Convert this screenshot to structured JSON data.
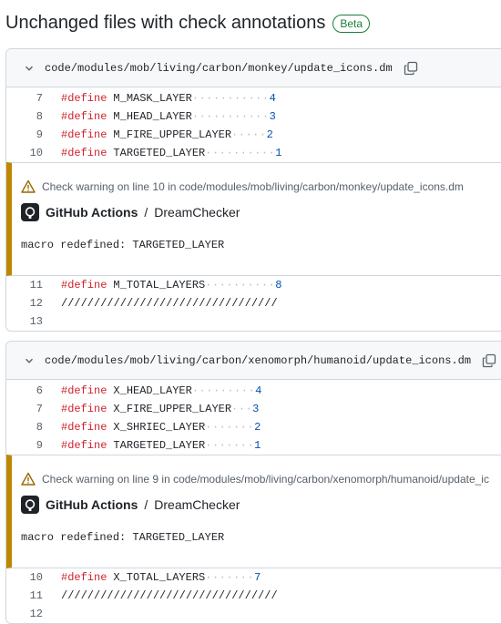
{
  "title": "Unchanged files with check annotations",
  "badge": "Beta",
  "files": [
    {
      "path": "code/modules/mob/living/carbon/monkey/update_icons.dm",
      "lines_before": [
        {
          "n": "7",
          "kw": "#define",
          "name": "M_MASK_LAYER",
          "dots": "···········",
          "val": "4"
        },
        {
          "n": "8",
          "kw": "#define",
          "name": "M_HEAD_LAYER",
          "dots": "···········",
          "val": "3"
        },
        {
          "n": "9",
          "kw": "#define",
          "name": "M_FIRE_UPPER_LAYER",
          "dots": "·····",
          "val": "2"
        },
        {
          "n": "10",
          "kw": "#define",
          "name": "TARGETED_LAYER",
          "dots": "··········",
          "val": "1"
        }
      ],
      "annotation": {
        "title": "Check warning on line 10 in code/modules/mob/living/carbon/monkey/update_icons.dm",
        "source_app": "GitHub Actions",
        "source_sep": "/",
        "source_check": "DreamChecker",
        "message": "macro redefined: TARGETED_LAYER"
      },
      "lines_after": [
        {
          "n": "11",
          "kw": "#define",
          "name": "M_TOTAL_LAYERS",
          "dots": "··········",
          "val": "8"
        },
        {
          "n": "12",
          "kw": "",
          "name": "/////////////////////////////////",
          "dots": "",
          "val": ""
        },
        {
          "n": "13",
          "kw": "",
          "name": "",
          "dots": "",
          "val": ""
        }
      ]
    },
    {
      "path": "code/modules/mob/living/carbon/xenomorph/humanoid/update_icons.dm",
      "lines_before": [
        {
          "n": "6",
          "kw": "#define",
          "name": "X_HEAD_LAYER",
          "dots": "·········",
          "val": "4"
        },
        {
          "n": "7",
          "kw": "#define",
          "name": "X_FIRE_UPPER_LAYER",
          "dots": "···",
          "val": "3"
        },
        {
          "n": "8",
          "kw": "#define",
          "name": "X_SHRIEC_LAYER",
          "dots": "·······",
          "val": "2"
        },
        {
          "n": "9",
          "kw": "#define",
          "name": "TARGETED_LAYER",
          "dots": "·······",
          "val": "1"
        }
      ],
      "annotation": {
        "title": "Check warning on line 9 in code/modules/mob/living/carbon/xenomorph/humanoid/update_ic",
        "source_app": "GitHub Actions",
        "source_sep": "/",
        "source_check": "DreamChecker",
        "message": "macro redefined: TARGETED_LAYER"
      },
      "lines_after": [
        {
          "n": "10",
          "kw": "#define",
          "name": "X_TOTAL_LAYERS",
          "dots": "·······",
          "val": "7"
        },
        {
          "n": "11",
          "kw": "",
          "name": "/////////////////////////////////",
          "dots": "",
          "val": ""
        },
        {
          "n": "12",
          "kw": "",
          "name": "",
          "dots": "",
          "val": ""
        }
      ]
    }
  ],
  "colors": {
    "warning": "#bf8700",
    "keyword": "#cf222e",
    "number": "#0550ae",
    "beta": "#1a7f37"
  }
}
